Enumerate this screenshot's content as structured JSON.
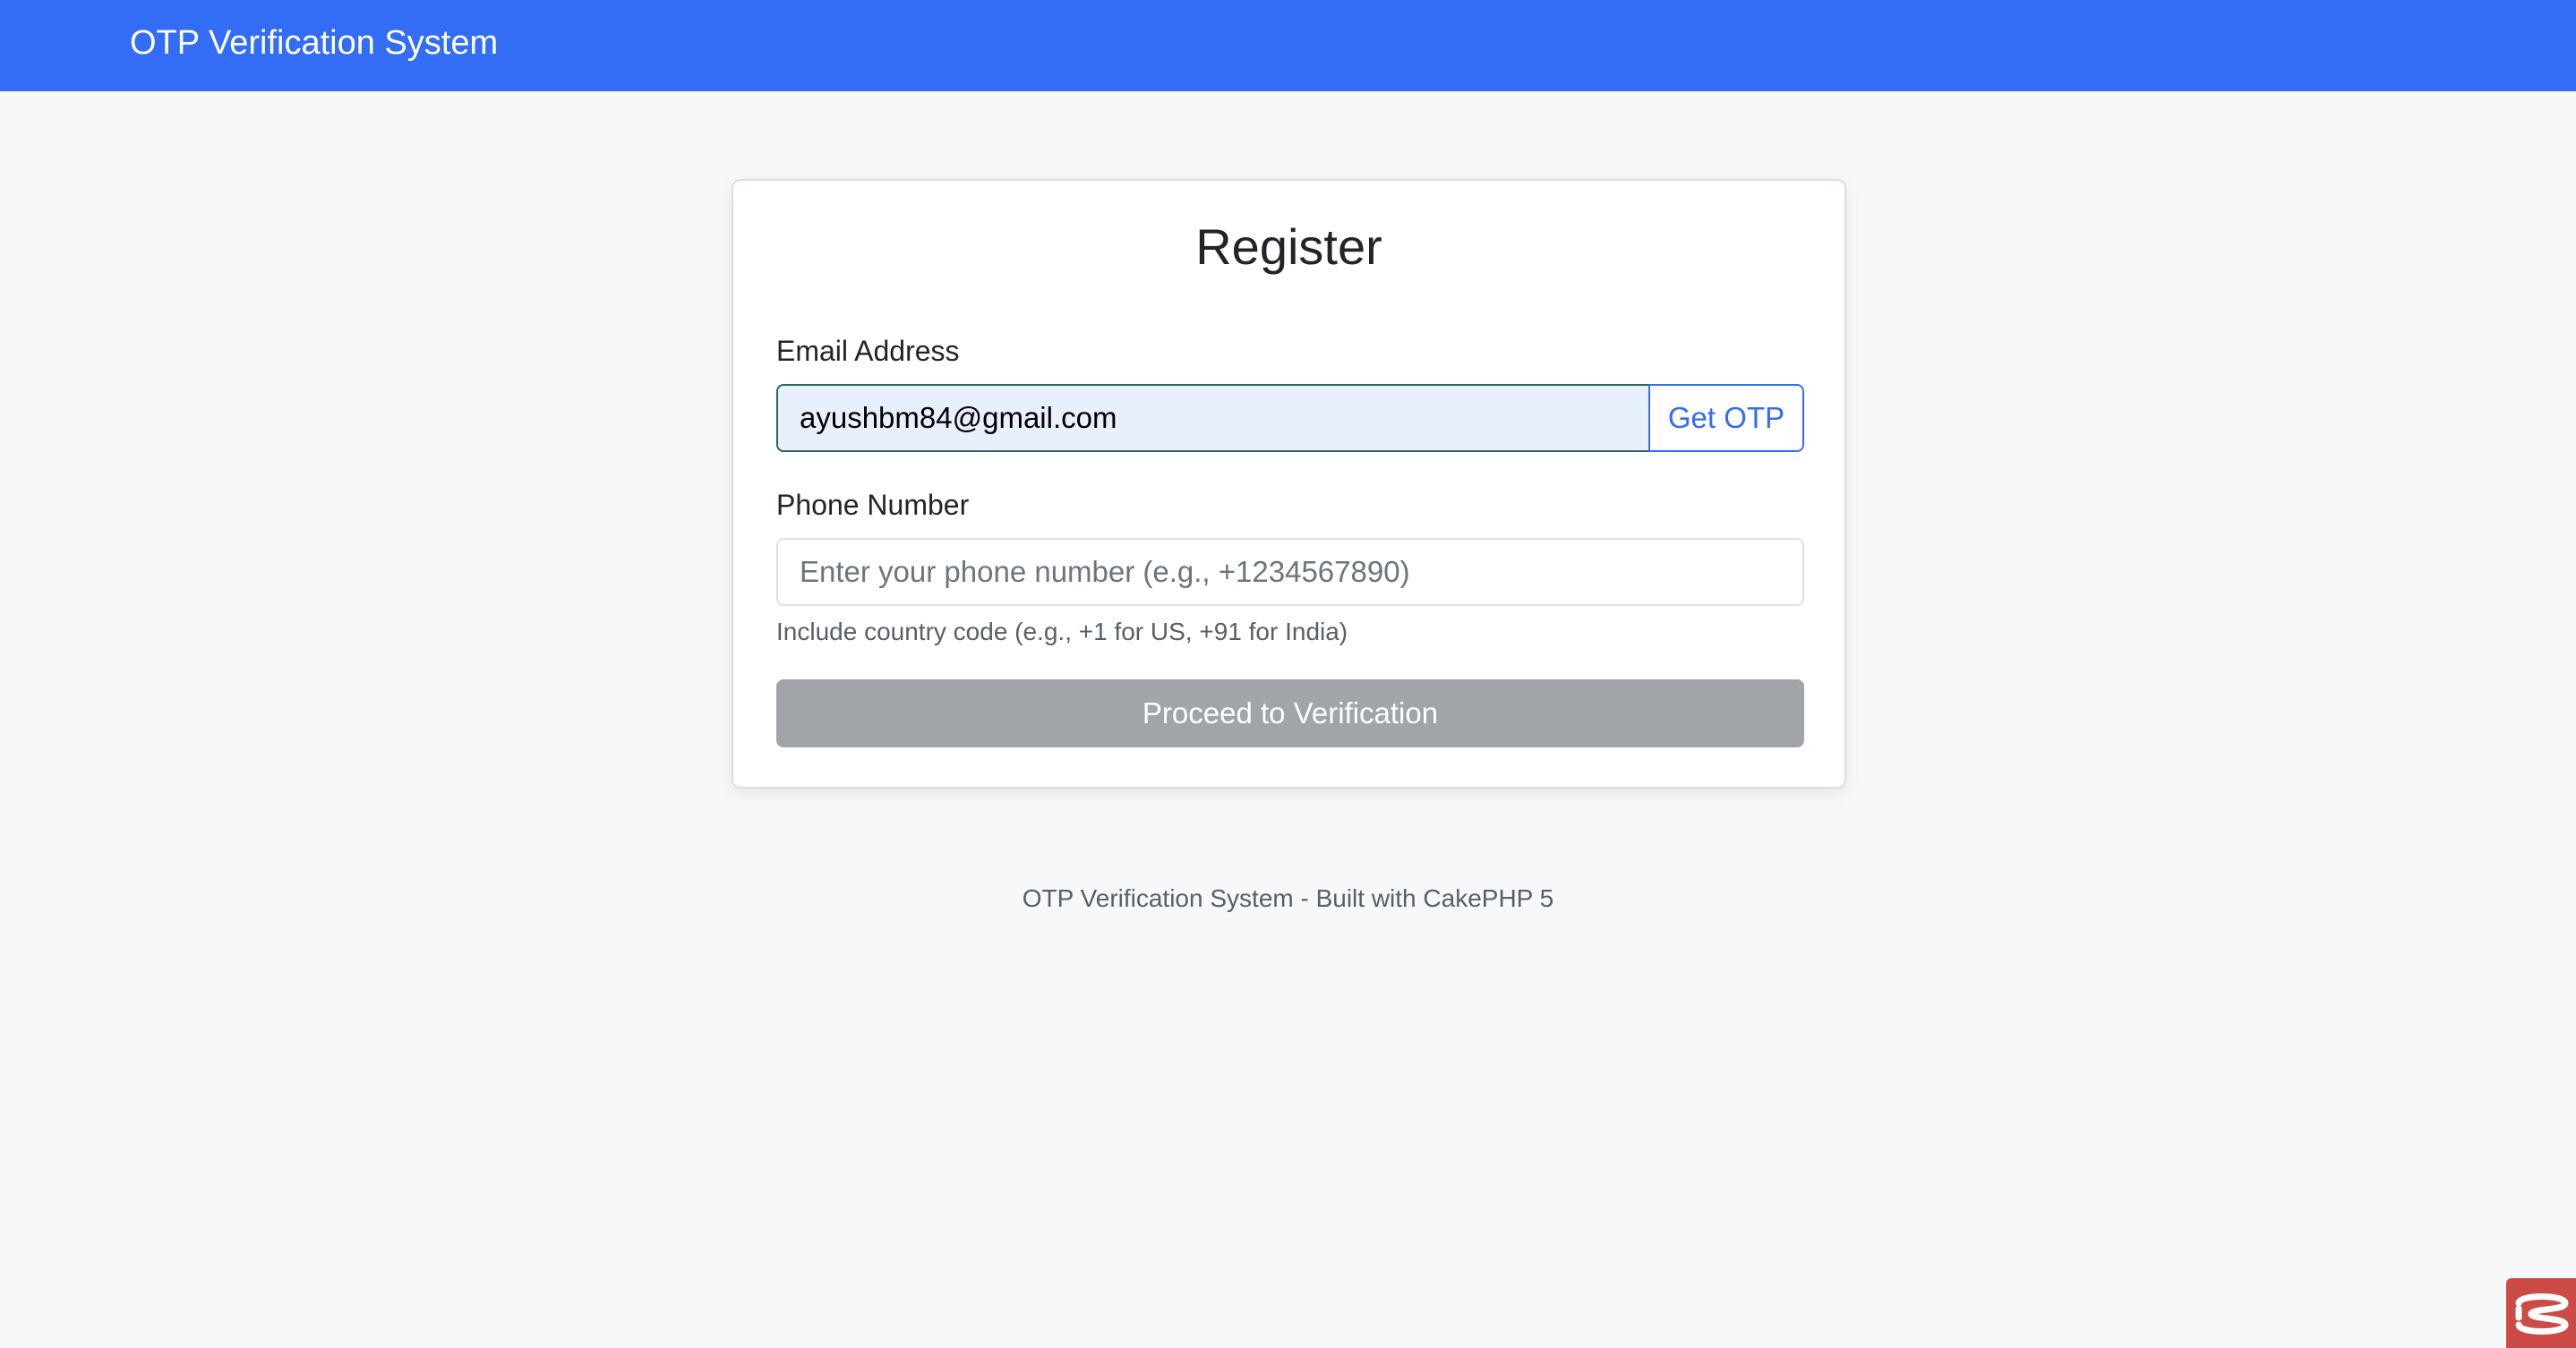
{
  "navbar": {
    "brand": "OTP Verification System",
    "color": "#336df5"
  },
  "form": {
    "title": "Register",
    "email": {
      "label": "Email Address",
      "value": "ayushbm84@gmail.com",
      "button_label": "Get OTP"
    },
    "phone": {
      "label": "Phone Number",
      "value": "",
      "placeholder": "Enter your phone number (e.g., +1234567890)",
      "help": "Include country code (e.g., +1 for US, +91 for India)"
    },
    "submit_label": "Proceed to Verification",
    "submit_disabled": true
  },
  "footer": {
    "text": "OTP Verification System - Built with CakePHP 5"
  },
  "debug_toolbar": {
    "icon": "cakephp-debugkit-icon",
    "color": "#cc4b47"
  }
}
